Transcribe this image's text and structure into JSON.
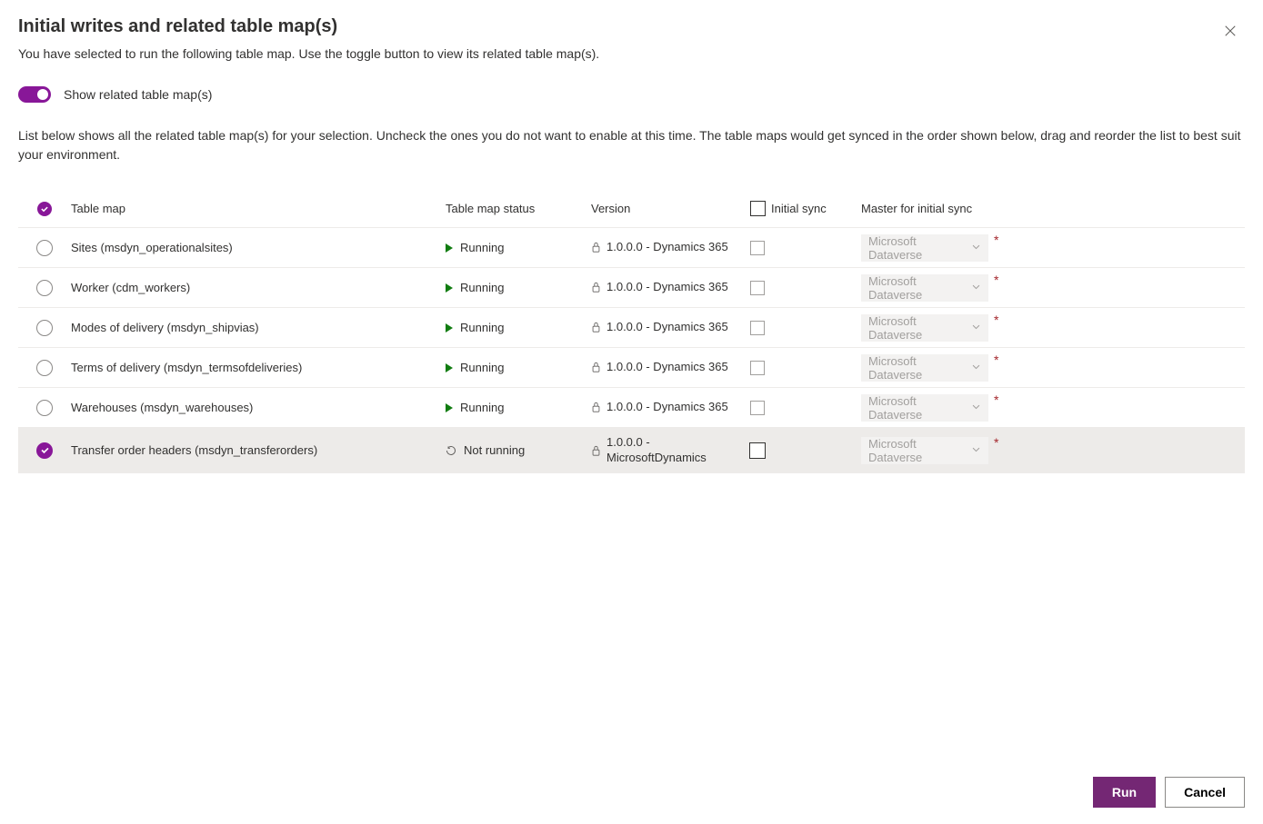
{
  "dialog": {
    "title": "Initial writes and related table map(s)",
    "subtitle": "You have selected to run the following table map. Use the toggle button to view its related table map(s).",
    "toggle_label": "Show related table map(s)",
    "instructions": "List below shows all the related table map(s) for your selection. Uncheck the ones you do not want to enable at this time. The table maps would get synced in the order shown below, drag and reorder the list to best suit your environment."
  },
  "columns": {
    "tablemap": "Table map",
    "status": "Table map status",
    "version": "Version",
    "initial_sync": "Initial sync",
    "master": "Master for initial sync"
  },
  "rows": [
    {
      "selected": false,
      "name": "Sites (msdyn_operationalsites)",
      "status": "Running",
      "running": true,
      "version": "1.0.0.0 - Dynamics 365",
      "master": "Microsoft Dataverse"
    },
    {
      "selected": false,
      "name": "Worker (cdm_workers)",
      "status": "Running",
      "running": true,
      "version": "1.0.0.0 - Dynamics 365",
      "master": "Microsoft Dataverse"
    },
    {
      "selected": false,
      "name": "Modes of delivery (msdyn_shipvias)",
      "status": "Running",
      "running": true,
      "version": "1.0.0.0 - Dynamics 365",
      "master": "Microsoft Dataverse"
    },
    {
      "selected": false,
      "name": "Terms of delivery (msdyn_termsofdeliveries)",
      "status": "Running",
      "running": true,
      "version": "1.0.0.0 - Dynamics 365",
      "master": "Microsoft Dataverse"
    },
    {
      "selected": false,
      "name": "Warehouses (msdyn_warehouses)",
      "status": "Running",
      "running": true,
      "version": "1.0.0.0 - Dynamics 365",
      "master": "Microsoft Dataverse"
    },
    {
      "selected": true,
      "name": "Transfer order headers (msdyn_transferorders)",
      "status": "Not running",
      "running": false,
      "version": "1.0.0.0 - MicrosoftDynamics",
      "master": "Microsoft Dataverse"
    }
  ],
  "buttons": {
    "run": "Run",
    "cancel": "Cancel"
  }
}
